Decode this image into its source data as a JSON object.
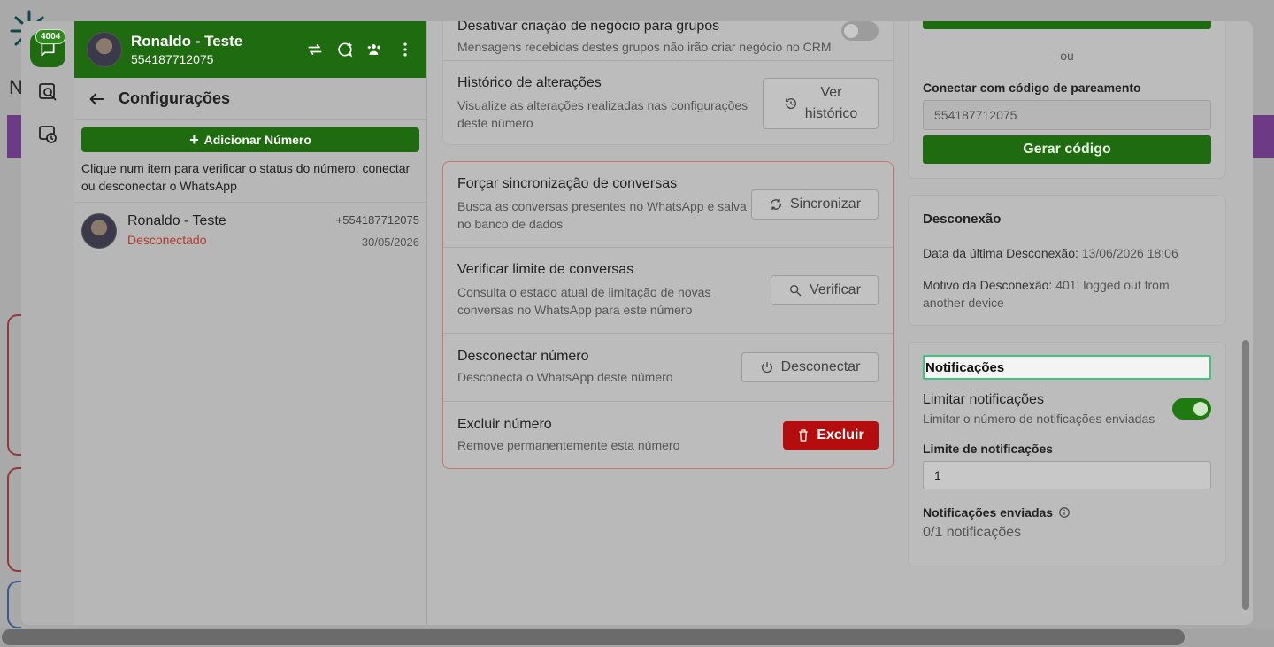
{
  "rail": {
    "badge": "4004"
  },
  "contact": {
    "name": "Ronaldo - Teste",
    "number": "554187712075"
  },
  "config": {
    "title": "Configurações",
    "add_label": "Adicionar Número",
    "hint": "Clique num item para verificar o status do número, conectar ou desconectar o WhatsApp",
    "item": {
      "name": "Ronaldo - Teste",
      "status": "Desconectado",
      "phone": "+554187712075",
      "date": "30/05/2026"
    }
  },
  "mid": {
    "top_partial_title": "Desativar criação de negócio para grupos",
    "top_partial_desc": "Mensagens recebidas destes grupos não irão criar negócio no CRM",
    "history_title": "Histórico de alterações",
    "history_desc": "Visualize as alterações realizadas nas configurações deste número",
    "history_btn_line1": "Ver",
    "history_btn_line2": "histórico",
    "sync_title": "Forçar sincronização de conversas",
    "sync_desc": "Busca as conversas presentes no WhatsApp e salva no banco de dados",
    "sync_btn": "Sincronizar",
    "verify_title": "Verificar limite de conversas",
    "verify_desc": "Consulta o estado atual de limitação de novas conversas no WhatsApp para este número",
    "verify_btn": "Verificar",
    "disconnect_title": "Desconectar número",
    "disconnect_desc": "Desconecta o WhatsApp deste número",
    "disconnect_btn": "Desconectar",
    "delete_title": "Excluir número",
    "delete_desc": "Remove permanentemente esta número",
    "delete_btn": "Excluir"
  },
  "right": {
    "or": "ou",
    "pair_label": "Conectar com código de pareamento",
    "pair_value": "554187712075",
    "gen_btn": "Gerar código",
    "disc_title": "Desconexão",
    "disc_last_label": "Data da última Desconexão:",
    "disc_last_value": "13/06/2026 18:06",
    "disc_reason_label": "Motivo da Desconexão:",
    "disc_reason_value": "401: logged out from another device",
    "notif_title": "Notificações",
    "limit_title": "Limitar notificações",
    "limit_desc": "Limitar o número de notificações enviadas",
    "limit_enabled": true,
    "limit_label": "Limite de notificações",
    "limit_value": "1",
    "sent_label": "Notificações enviadas",
    "sent_value": "0/1 notificações"
  },
  "colors": {
    "brand_green": "#1e6b10",
    "danger": "#b50d0d",
    "toggle_on": "#1f7a12"
  }
}
